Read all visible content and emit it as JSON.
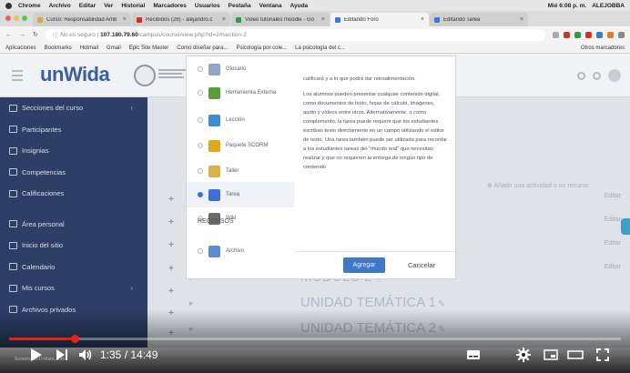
{
  "menubar": {
    "items": [
      "Chrome",
      "Archivo",
      "Editar",
      "Ver",
      "Historial",
      "Marcadores",
      "Usuarios",
      "Pestaña",
      "Ventana",
      "Ayuda"
    ],
    "right": [
      "Mié 6:08 p. m.",
      "ALEJOBBA"
    ]
  },
  "tabs": [
    {
      "label": "Curso: Responsabilidad Amb",
      "color": "#e9a13a",
      "active": false
    },
    {
      "label": "Recibidos (26) - alejandro.c",
      "color": "#d93025",
      "active": false
    },
    {
      "label": "Video tutoriales moodle - Go",
      "color": "#2d9a4e",
      "active": false
    },
    {
      "label": "Editando Foro",
      "color": "#3d7ad6",
      "active": true
    },
    {
      "label": "Editando Tarea",
      "color": "#3d7ad6",
      "active": false
    }
  ],
  "address": {
    "insecure": "No es seguro",
    "host": "107.180.79.60",
    "path": "/campus/course/view.php?id=2#section-2"
  },
  "bookmarks": [
    "Aplicaciones",
    "Bookmarks",
    "Hotmail",
    "Gmail",
    "Epic Site Master",
    "Como diseñar para...",
    "Psicología por cole...",
    "La psicología del c..."
  ],
  "bookmarks_other": "Otros marcadores",
  "header": {
    "logo": "unWida"
  },
  "sidebar": {
    "items": [
      {
        "label": "Secciones del curso",
        "chevron": "‹"
      },
      {
        "label": "Participantes",
        "chevron": ""
      },
      {
        "label": "Insignias",
        "chevron": ""
      },
      {
        "label": "Competencias",
        "chevron": ""
      },
      {
        "label": "Calificaciones",
        "chevron": ""
      },
      {
        "label": "Área personal",
        "chevron": ""
      },
      {
        "label": "Inicio del sitio",
        "chevron": ""
      },
      {
        "label": "Calendario",
        "chevron": ""
      },
      {
        "label": "Mis cursos",
        "chevron": "‹"
      },
      {
        "label": "Archivos privados",
        "chevron": ""
      }
    ]
  },
  "content": {
    "add_activity": "Añadir una actividad o un recurso",
    "editar": "Editar",
    "units": [
      "MÓDULO 2",
      "UNIDAD TEMÁTICA 1",
      "UNIDAD TEMÁTICA 2"
    ]
  },
  "modal": {
    "items": [
      {
        "label": "Glosario",
        "color": "#8fa6c8"
      },
      {
        "label": "Herramienta Externa",
        "color": "#5a9e3c"
      },
      {
        "label": "Lección",
        "color": "#3d8fd4"
      },
      {
        "label": "Paquete SCORM",
        "color": "#e0a81a"
      },
      {
        "label": "Taller",
        "color": "#d9b24a"
      },
      {
        "label": "Tarea",
        "color": "#3d6fd6"
      },
      {
        "label": "Wiki",
        "color": "#6b6b6b"
      }
    ],
    "selected_index": 5,
    "section_heading": "RECURSOS",
    "resource_item": {
      "label": "Archivo",
      "color": "#5b8bd0"
    },
    "description": [
      "calificará y a lo que podrá dar retroalimentación.",
      "Los alumnos pueden presentar cualquier contenido digital, como documentos de texto, hojas de cálculo, imágenes, audio y vídeos entre otros. Alternativamente, o como complemento, la tarea puede requerir que los estudiantes escriban texto directamente en un campo utilizando el editor de texto. Una tarea también puede ser utilizada para recordar a los estudiantes tareas del \"mundo real\" que necesitan realizar y que no requieren la entrega de ningún tipo de contenido"
    ],
    "add_label": "Agregar",
    "cancel_label": "Cancelar"
  },
  "video": {
    "time": "1:35 / 14:49",
    "progress": 0.107,
    "watermark": "Screencast-O-Matic.com"
  }
}
